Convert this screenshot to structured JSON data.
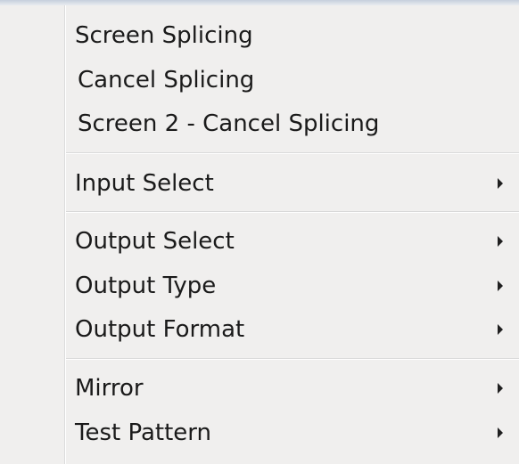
{
  "menu": {
    "items": [
      {
        "label": "Screen Splicing",
        "has_submenu": false
      },
      {
        "label": "Cancel Splicing",
        "has_submenu": false
      },
      {
        "label": "Screen 2 - Cancel Splicing",
        "has_submenu": false
      },
      {
        "label": "Input Select",
        "has_submenu": true
      },
      {
        "label": "Output Select",
        "has_submenu": true
      },
      {
        "label": "Output Type",
        "has_submenu": true
      },
      {
        "label": "Output Format",
        "has_submenu": true
      },
      {
        "label": "Mirror",
        "has_submenu": true
      },
      {
        "label": "Test Pattern",
        "has_submenu": true
      }
    ]
  },
  "colors": {
    "background": "#f0efee",
    "text": "#1a1a1a",
    "separator": "#d9d9d9"
  },
  "icons": {
    "submenu": "chevron-right-icon"
  }
}
